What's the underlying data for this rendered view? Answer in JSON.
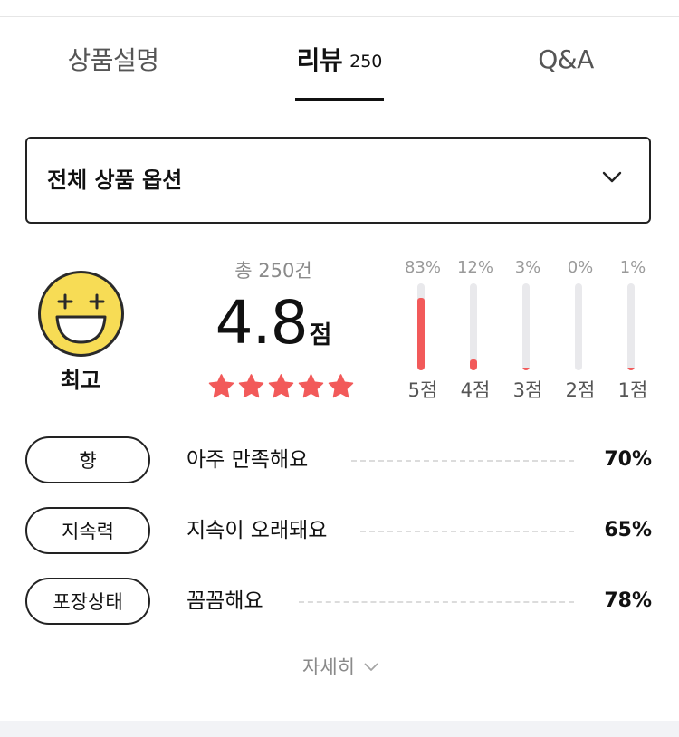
{
  "tabs": [
    {
      "label": "상품설명",
      "count": null,
      "active": false
    },
    {
      "label": "리뷰",
      "count": "250",
      "active": true
    },
    {
      "label": "Q&A",
      "count": null,
      "active": false
    }
  ],
  "option_select": {
    "label": "전체 상품 옵션",
    "icon": "chevron-down-icon"
  },
  "summary": {
    "badge_icon": "grinning-face-icon",
    "badge_label": "최고",
    "total_count": "총 250건",
    "rating": "4.8",
    "rating_unit": "점",
    "stars_filled": 5,
    "star_color": "#f25a5a"
  },
  "distribution": [
    {
      "label": "5점",
      "percent_text": "83%",
      "percent": 83
    },
    {
      "label": "4점",
      "percent_text": "12%",
      "percent": 12
    },
    {
      "label": "3점",
      "percent_text": "3%",
      "percent": 3
    },
    {
      "label": "2점",
      "percent_text": "0%",
      "percent": 0
    },
    {
      "label": "1점",
      "percent_text": "1%",
      "percent": 1
    }
  ],
  "attributes": [
    {
      "name": "향",
      "description": "아주 만족해요",
      "percent": "70%"
    },
    {
      "name": "지속력",
      "description": "지속이 오래돼요",
      "percent": "65%"
    },
    {
      "name": "포장상태",
      "description": "꼼꼼해요",
      "percent": "78%"
    }
  ],
  "more": {
    "label": "자세히",
    "icon": "chevron-down-icon"
  },
  "colors": {
    "accent": "#f25a5a",
    "badge_yellow": "#f7dc55",
    "track": "#e9e9ec"
  }
}
